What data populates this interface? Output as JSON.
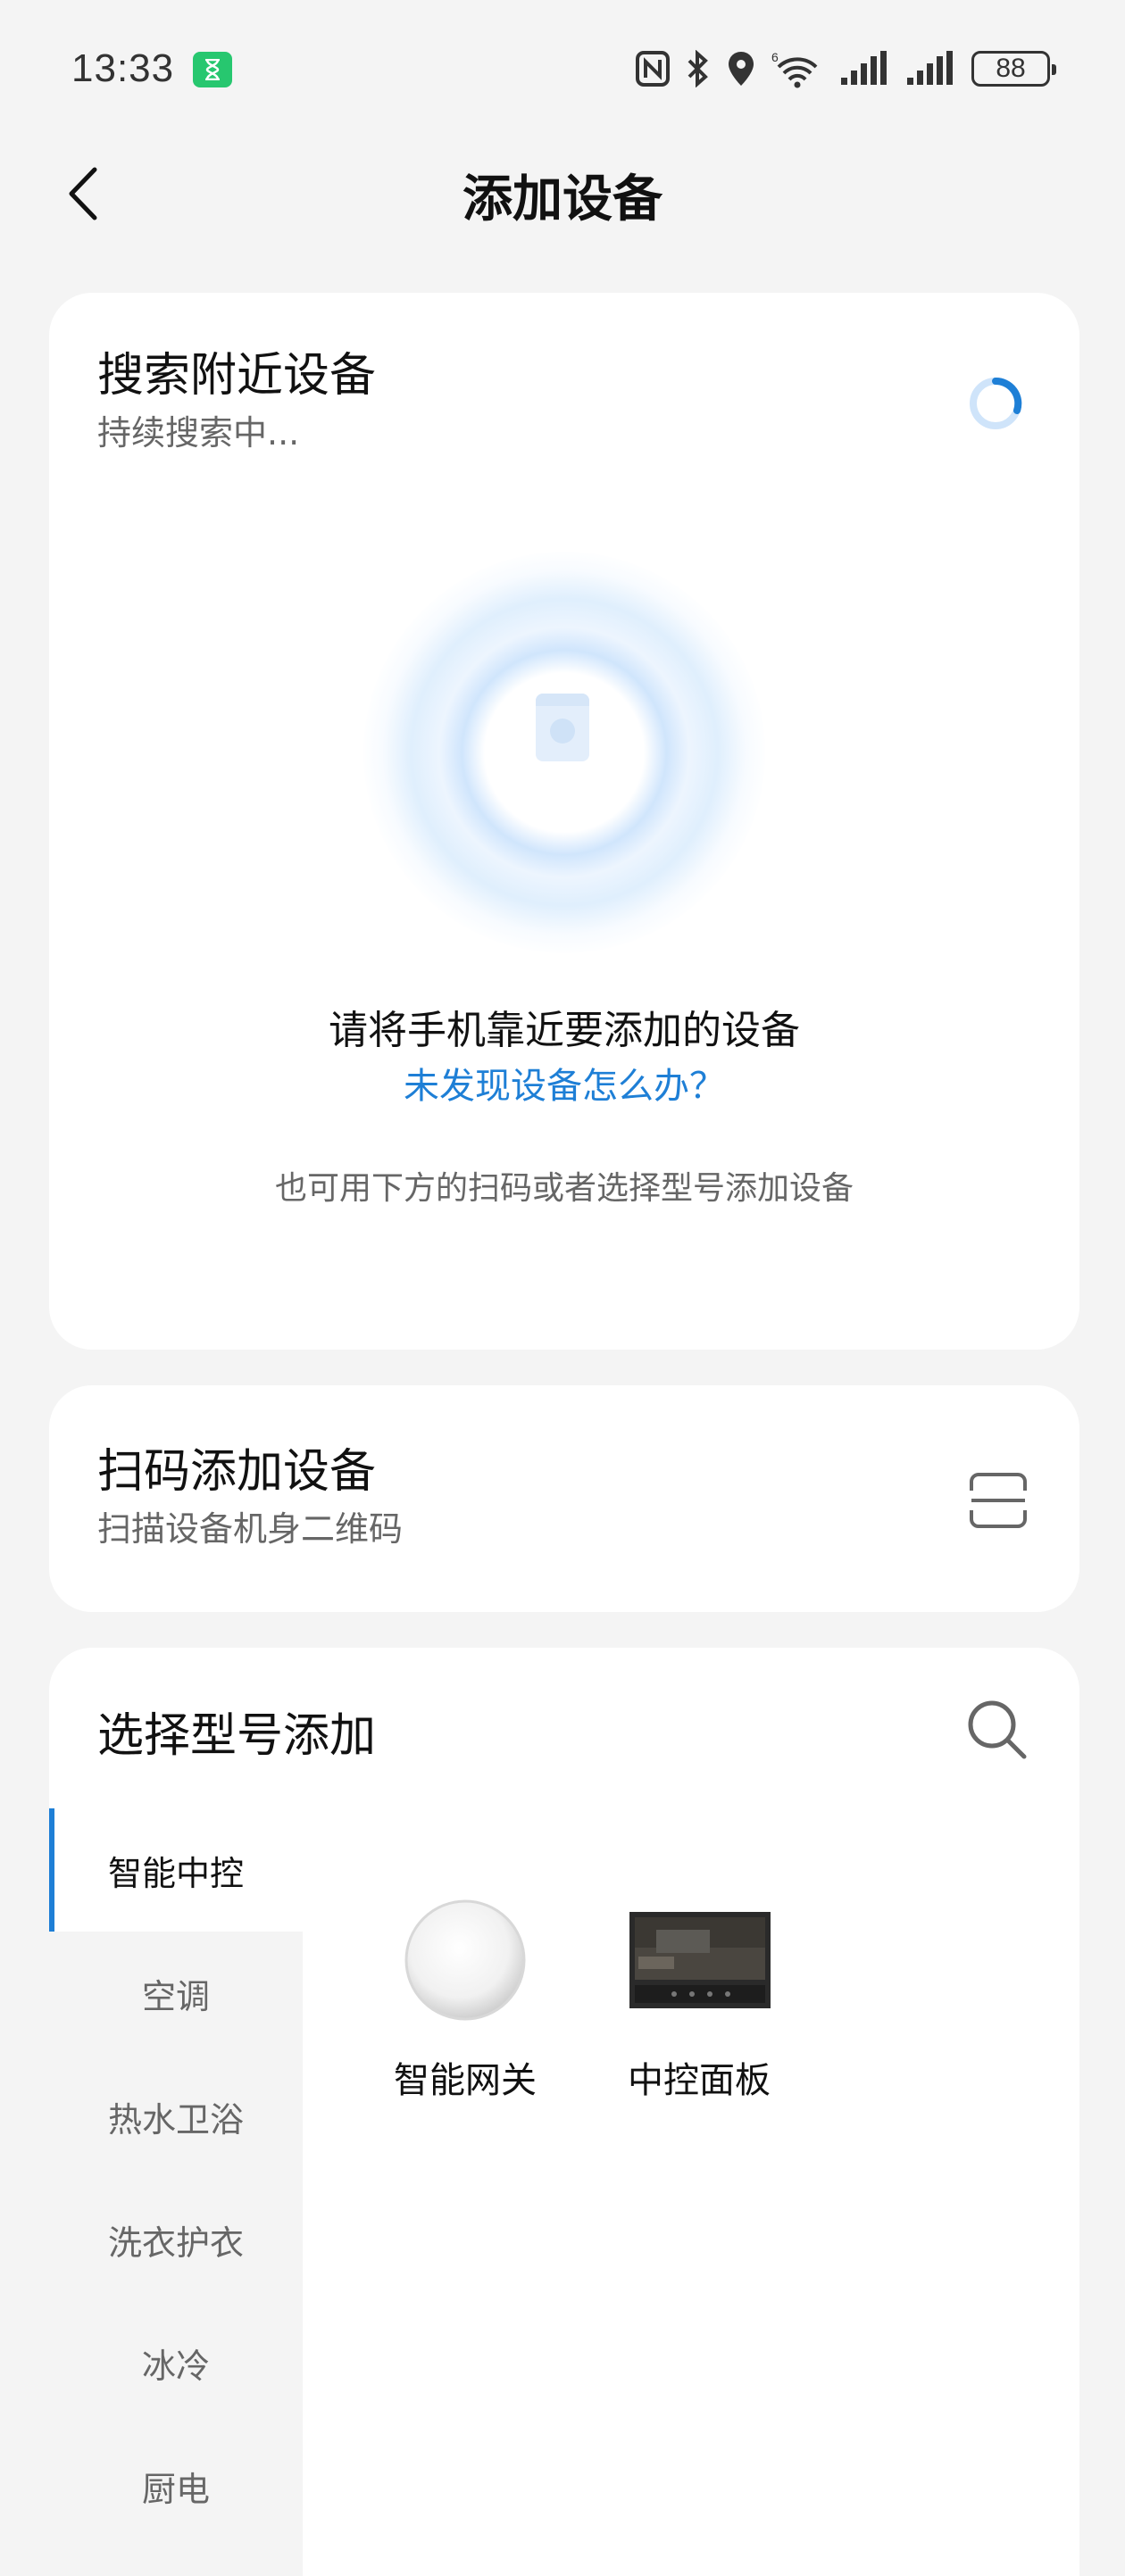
{
  "status_bar": {
    "time": "13:33",
    "battery": "88",
    "icons": [
      "nfc-icon",
      "bluetooth-icon",
      "location-icon",
      "wifi-icon",
      "signal-icon",
      "signal-icon"
    ]
  },
  "header": {
    "title": "添加设备",
    "back_icon": "chevron-left-icon"
  },
  "search_card": {
    "title": "搜索附近设备",
    "subtitle": "持续搜索中...",
    "hint": "请将手机靠近要添加的设备",
    "help_link": "未发现设备怎么办？",
    "alt_hint": "也可用下方的扫码或者选择型号添加设备"
  },
  "scan_card": {
    "title": "扫码添加设备",
    "subtitle": "扫描设备机身二维码",
    "icon": "scan-icon"
  },
  "model_card": {
    "title": "选择型号添加",
    "search_icon": "search-icon",
    "categories": [
      {
        "label": "智能中控",
        "active": true
      },
      {
        "label": "空调",
        "active": false
      },
      {
        "label": "热水卫浴",
        "active": false
      },
      {
        "label": "洗衣护衣",
        "active": false
      },
      {
        "label": "冰冷",
        "active": false
      },
      {
        "label": "厨电",
        "active": false
      }
    ],
    "products": [
      {
        "label": "智能网关"
      },
      {
        "label": "中控面板"
      }
    ]
  },
  "colors": {
    "accent": "#1e7fd6",
    "background": "#f4f4f4",
    "card": "#ffffff"
  }
}
